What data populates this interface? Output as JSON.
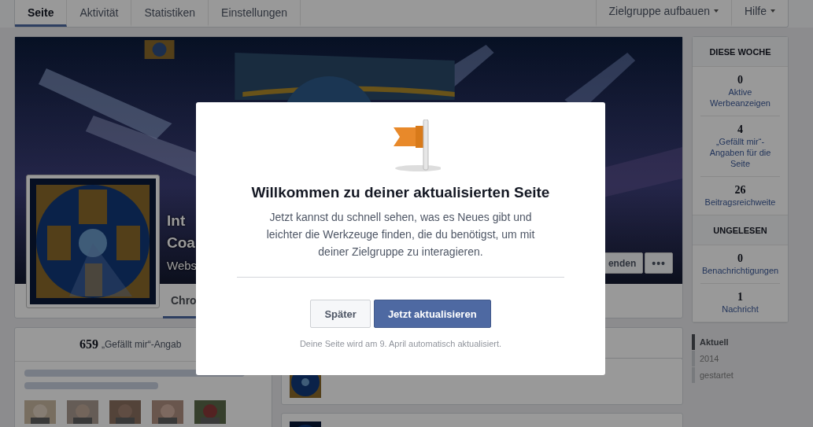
{
  "nav": {
    "tabs": [
      {
        "label": "Seite",
        "selected": true
      },
      {
        "label": "Aktivität",
        "selected": false
      },
      {
        "label": "Statistiken",
        "selected": false
      },
      {
        "label": "Einstellungen",
        "selected": false
      }
    ],
    "menus": [
      {
        "label": "Zielgruppe aufbauen"
      },
      {
        "label": "Hilfe"
      }
    ]
  },
  "profile": {
    "name_lines": [
      "Int",
      "Coa"
    ],
    "category": "Webs",
    "action_button": "enden",
    "more_button": "•••"
  },
  "page_tabs": [
    {
      "label": "Chro",
      "selected": true
    }
  ],
  "likes_card": {
    "count": "659",
    "label": "„Gefällt mir“-Angab"
  },
  "sidebar": {
    "sections": [
      {
        "heading": "DIESE WOCHE",
        "stats": [
          {
            "value": "0",
            "label": "Aktive Werbeanzeigen"
          },
          {
            "value": "4",
            "label": "„Gefällt mir“-Angaben für die Seite"
          },
          {
            "value": "26",
            "label": "Beitragsreichweite"
          }
        ]
      },
      {
        "heading": "UNGELESEN",
        "stats": [
          {
            "value": "0",
            "label": "Benachrichtigungen"
          },
          {
            "value": "1",
            "label": "Nachricht"
          }
        ]
      }
    ]
  },
  "timeline": [
    {
      "label": "Aktuell",
      "selected": true
    },
    {
      "label": "2014",
      "selected": false
    },
    {
      "label": "gestartet",
      "selected": false
    }
  ],
  "dialog": {
    "title": "Willkommen zu deiner aktualisierten Seite",
    "text": "Jetzt kannst du schnell sehen, was es Neues gibt und leichter die Werkzeuge finden, die du benötigst, um mit deiner Zielgruppe zu interagieren.",
    "buttons": [
      {
        "label": "Später",
        "kind": "secondary"
      },
      {
        "label": "Jetzt aktualisieren",
        "kind": "primary"
      }
    ],
    "note": "Deine Seite wird am 9. April automatisch aktualisiert."
  }
}
